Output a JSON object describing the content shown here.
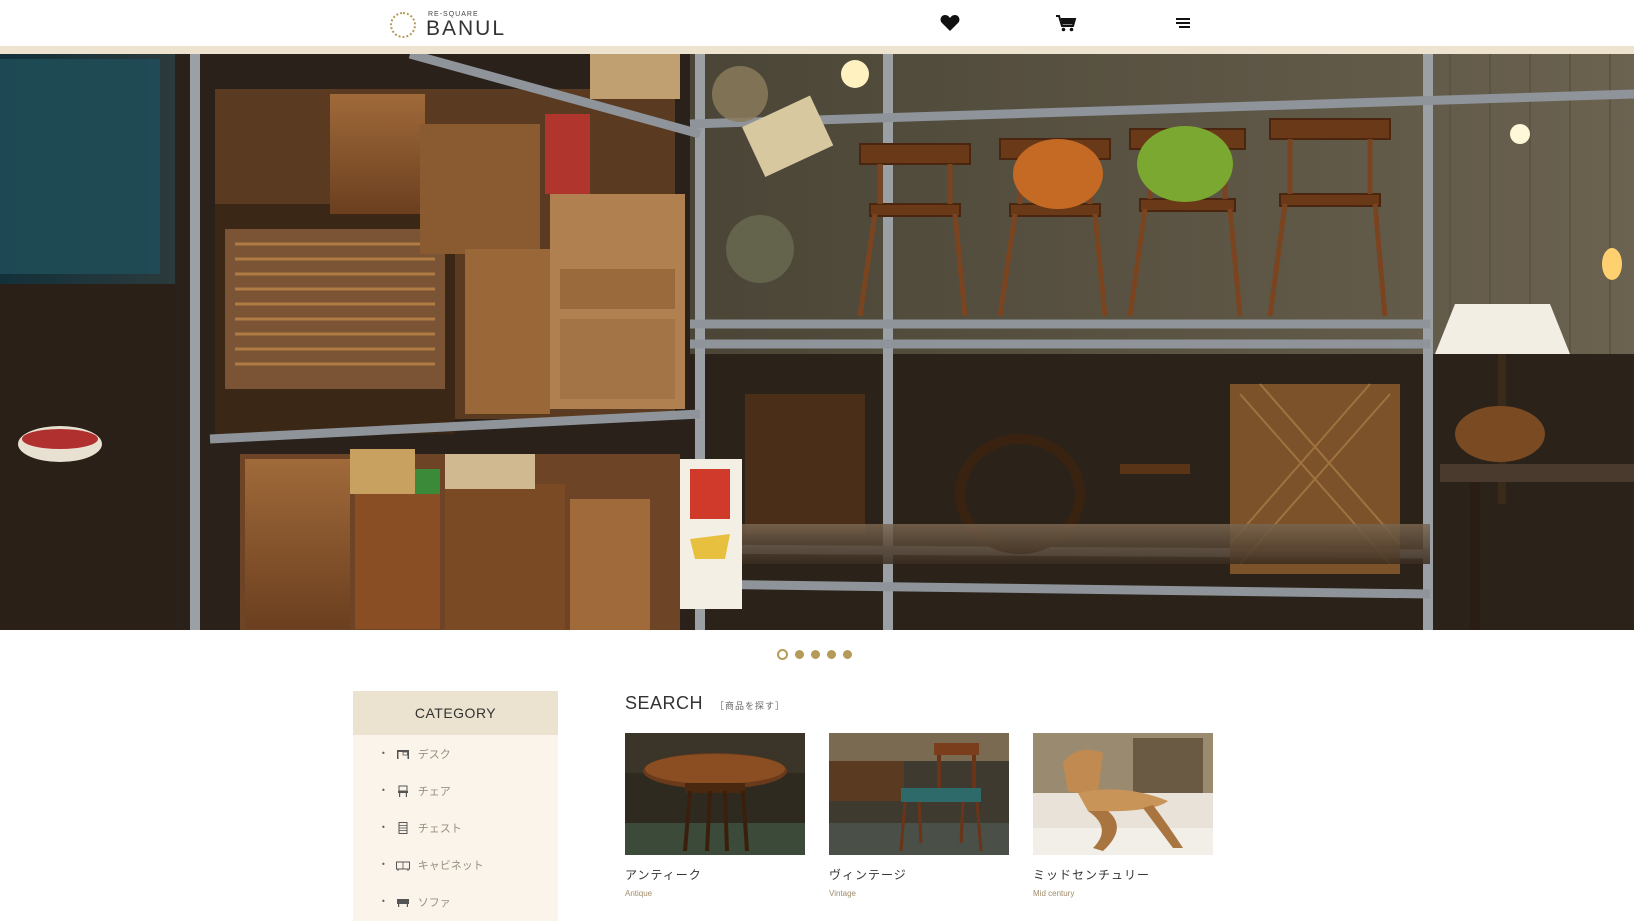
{
  "header": {
    "logo_small": "RE-SQUARE",
    "logo_big": "BAΝUL",
    "icons": [
      "heart-icon",
      "cart-icon",
      "menu-icon"
    ]
  },
  "colors": {
    "stripe": "#ede3cf",
    "accent": "#b59a5a",
    "category_bg": "#faf4ea",
    "category_head_bg": "#ebe2cf"
  },
  "carousel": {
    "slide_count": 5,
    "active_index": 0
  },
  "category": {
    "title": "CATEGORY",
    "items": [
      {
        "label": "デスク",
        "icon": "desk-icon"
      },
      {
        "label": "チェア",
        "icon": "chair-icon"
      },
      {
        "label": "チェスト",
        "icon": "chest-icon"
      },
      {
        "label": "キャビネット",
        "icon": "cabinet-icon"
      },
      {
        "label": "ソファ",
        "icon": "sofa-icon"
      }
    ]
  },
  "search": {
    "title": "SEARCH",
    "subtitle": "［商品を探す］",
    "cards": [
      {
        "title": "アンティーク",
        "subtitle": "Antique"
      },
      {
        "title": "ヴィンテージ",
        "subtitle": "Vintage"
      },
      {
        "title": "ミッドセンチュリー",
        "subtitle": "Mid century"
      }
    ]
  }
}
